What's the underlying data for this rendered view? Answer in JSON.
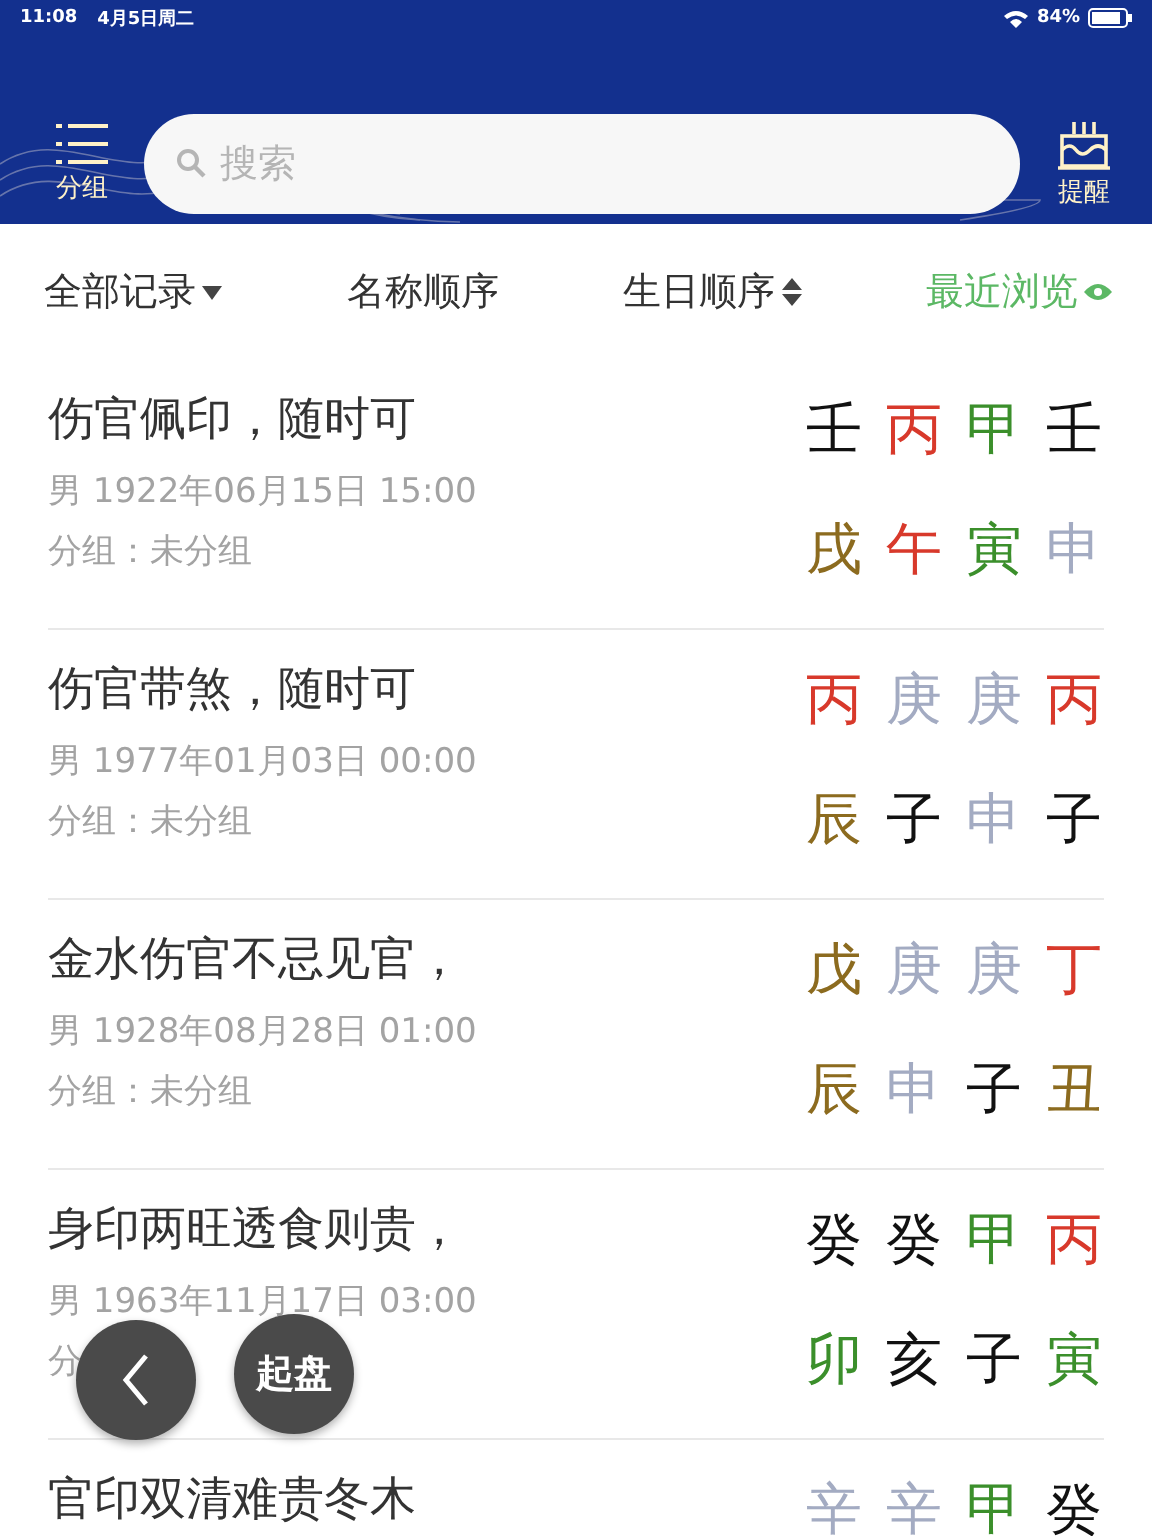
{
  "status_bar": {
    "time": "11:08",
    "date": "4月5日周二",
    "battery": "84%"
  },
  "header": {
    "group_label": "分组",
    "search": {
      "placeholder": "搜索"
    },
    "remind_label": "提醒"
  },
  "filters": [
    {
      "label": "全部记录",
      "kind": "dropdown",
      "selected": false
    },
    {
      "label": "名称顺序",
      "kind": "plain",
      "selected": false
    },
    {
      "label": "生日顺序",
      "kind": "sort",
      "selected": false
    },
    {
      "label": "最近浏览",
      "kind": "eye",
      "selected": true
    }
  ],
  "records": [
    {
      "title": "伤官佩印，随时可",
      "birth": "男 1922年06月15日 15:00",
      "group": "分组：未分组",
      "stems": [
        {
          "char": "壬",
          "color": "#111111"
        },
        {
          "char": "丙",
          "color": "#d8392b"
        },
        {
          "char": "甲",
          "color": "#3b8f2b"
        },
        {
          "char": "壬",
          "color": "#111111"
        }
      ],
      "branches": [
        {
          "char": "戌",
          "color": "#8c6b1f"
        },
        {
          "char": "午",
          "color": "#d8392b"
        },
        {
          "char": "寅",
          "color": "#3b8f2b"
        },
        {
          "char": "申",
          "color": "#a3abc2"
        }
      ]
    },
    {
      "title": "伤官带煞，随时可",
      "birth": "男 1977年01月03日 00:00",
      "group": "分组：未分组",
      "stems": [
        {
          "char": "丙",
          "color": "#d8392b"
        },
        {
          "char": "庚",
          "color": "#a3abc2"
        },
        {
          "char": "庚",
          "color": "#a3abc2"
        },
        {
          "char": "丙",
          "color": "#d8392b"
        }
      ],
      "branches": [
        {
          "char": "辰",
          "color": "#8c6b1f"
        },
        {
          "char": "子",
          "color": "#111111"
        },
        {
          "char": "申",
          "color": "#a3abc2"
        },
        {
          "char": "子",
          "color": "#111111"
        }
      ]
    },
    {
      "title": "金水伤官不忌见官，",
      "birth": "男 1928年08月28日 01:00",
      "group": "分组：未分组",
      "stems": [
        {
          "char": "戊",
          "color": "#8c6b1f"
        },
        {
          "char": "庚",
          "color": "#a3abc2"
        },
        {
          "char": "庚",
          "color": "#a3abc2"
        },
        {
          "char": "丁",
          "color": "#d8392b"
        }
      ],
      "branches": [
        {
          "char": "辰",
          "color": "#8c6b1f"
        },
        {
          "char": "申",
          "color": "#a3abc2"
        },
        {
          "char": "子",
          "color": "#111111"
        },
        {
          "char": "丑",
          "color": "#8c6b1f"
        }
      ]
    },
    {
      "title": "身印两旺透食则贵，",
      "birth": "男 1963年11月17日 03:00",
      "group": "分",
      "stems": [
        {
          "char": "癸",
          "color": "#111111"
        },
        {
          "char": "癸",
          "color": "#111111"
        },
        {
          "char": "甲",
          "color": "#3b8f2b"
        },
        {
          "char": "丙",
          "color": "#d8392b"
        }
      ],
      "branches": [
        {
          "char": "卯",
          "color": "#3b8f2b"
        },
        {
          "char": "亥",
          "color": "#111111"
        },
        {
          "char": "子",
          "color": "#111111"
        },
        {
          "char": "寅",
          "color": "#3b8f2b"
        }
      ]
    },
    {
      "title": "官印双清难贵冬木",
      "stems": [
        {
          "char": "辛",
          "color": "#a3abc2"
        },
        {
          "char": "辛",
          "color": "#a3abc2"
        },
        {
          "char": "甲",
          "color": "#3b8f2b"
        },
        {
          "char": "癸",
          "color": "#111111"
        }
      ]
    }
  ],
  "fab": {
    "start_label": "起盘"
  }
}
